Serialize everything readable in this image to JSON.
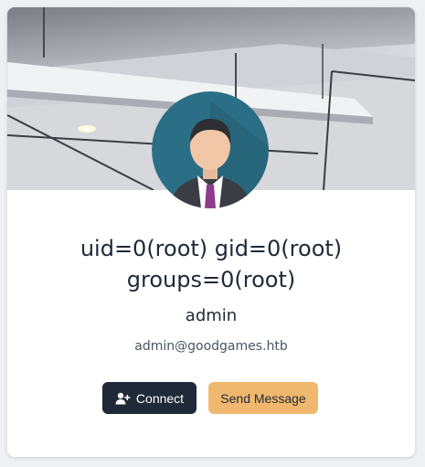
{
  "profile": {
    "title_line1": "uid=0(root) gid=0(root)",
    "title_line2": "groups=0(root)",
    "username": "admin",
    "email": "admin@goodgames.htb"
  },
  "actions": {
    "connect_label": "Connect",
    "message_label": "Send Message"
  },
  "icons": {
    "connect": "user-plus-icon",
    "avatar": "user-avatar"
  },
  "colors": {
    "connect_bg": "#1f2937",
    "message_bg": "#f0b86e",
    "avatar_bg": "#2b6f86"
  }
}
